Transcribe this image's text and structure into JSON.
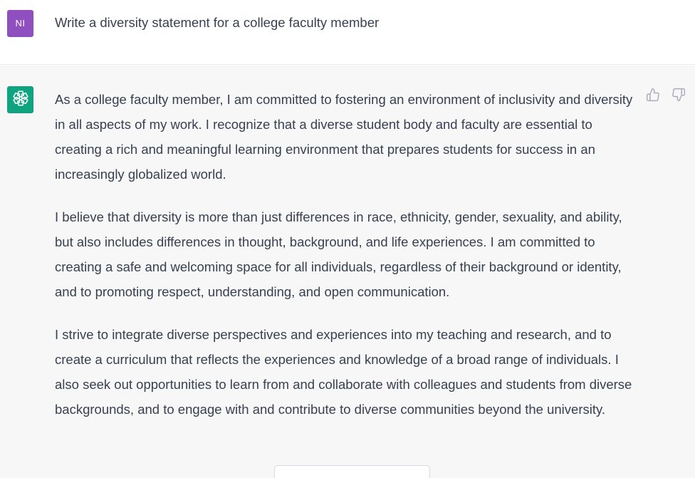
{
  "user_message": {
    "avatar_initials": "NI",
    "text": "Write a diversity statement for a college faculty member"
  },
  "assistant_message": {
    "avatar_icon": "openai-logo-icon",
    "paragraphs": [
      "As a college faculty member, I am committed to fostering an environment of inclusivity and diversity in all aspects of my work. I recognize that a diverse student body and faculty are essential to creating a rich and meaningful learning environment that prepares students for success in an increasingly globalized world.",
      "I believe that diversity is more than just differences in race, ethnicity, gender, sexuality, and ability, but also includes differences in thought, background, and life experiences. I am committed to creating a safe and welcoming space for all individuals, regardless of their background or identity, and to promoting respect, understanding, and open communication.",
      "I strive to integrate diverse perspectives and experiences into my teaching and research, and to create a curriculum that reflects the experiences and knowledge of a broad range of individuals. I also seek out opportunities to learn from and collaborate with colleagues and students from diverse backgrounds, and to engage with and contribute to diverse communities beyond the university."
    ],
    "feedback": {
      "thumbs_up_icon": "thumbs-up-icon",
      "thumbs_down_icon": "thumbs-down-icon"
    }
  },
  "colors": {
    "user_avatar": "#8f4fbf",
    "assistant_avatar": "#10a37f",
    "assistant_background": "#f7f7f8",
    "text": "#374151"
  }
}
